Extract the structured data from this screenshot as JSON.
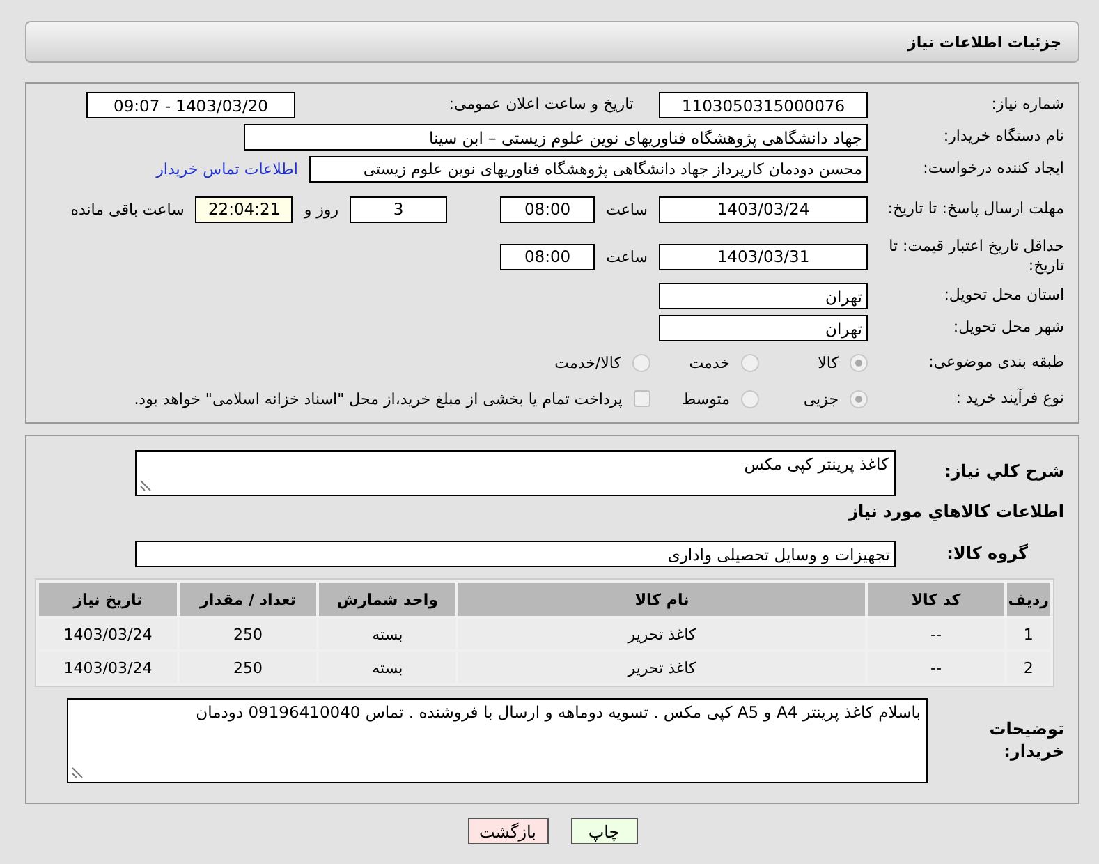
{
  "header": {
    "title": "جزئیات اطلاعات نیاز"
  },
  "details": {
    "need_number": {
      "label": "شماره نیاز:",
      "value": "1103050315000076"
    },
    "announce": {
      "label": "تاریخ و ساعت اعلان عمومی:",
      "value": "1403/03/20 - 09:07"
    },
    "buyer_org": {
      "label": "نام دستگاه خریدار:",
      "value": "جهاد دانشگاهی پژوهشگاه فناوریهای نوین علوم زیستی – ابن سینا"
    },
    "requester": {
      "label": "ایجاد کننده درخواست:",
      "value": "محسن دودمان کارپرداز جهاد دانشگاهی پژوهشگاه فناوریهای نوین علوم زیستی",
      "link": "اطلاعات تماس خریدار"
    },
    "deadline": {
      "label": "مهلت ارسال پاسخ: تا تاریخ:",
      "date": "1403/03/24",
      "time_label": "ساعت",
      "time": "08:00",
      "days": "3",
      "days_label": "روز و",
      "remaining": "22:04:21",
      "remaining_label": "ساعت باقی مانده"
    },
    "validity": {
      "label": "حداقل تاریخ اعتبار قیمت: تا تاریخ:",
      "date": "1403/03/31",
      "time_label": "ساعت",
      "time": "08:00"
    },
    "province": {
      "label": "استان محل تحویل:",
      "value": "تهران"
    },
    "city": {
      "label": "شهر محل تحویل:",
      "value": "تهران"
    },
    "category": {
      "label": "طبقه بندی موضوعی:",
      "options": [
        {
          "label": "کالا",
          "selected": true
        },
        {
          "label": "خدمت",
          "selected": false
        },
        {
          "label": "کالا/خدمت",
          "selected": false
        }
      ]
    },
    "process": {
      "label": "نوع فرآیند خرید :",
      "options": [
        {
          "label": "جزیی",
          "selected": true
        },
        {
          "label": "متوسط",
          "selected": false
        }
      ],
      "treasury": {
        "label": "پرداخت تمام یا بخشی از مبلغ خرید،از محل \"اسناد خزانه اسلامی\" خواهد بود.",
        "checked": false
      }
    }
  },
  "goods": {
    "description": {
      "label": "شرح کلي نياز:",
      "value": "کاغذ پرینتر کپی مکس"
    },
    "heading": "اطلاعات کالاهاي مورد نياز",
    "group": {
      "label": "گروه کالا:",
      "value": "تجهیزات و وسایل تحصیلی واداری"
    },
    "table": {
      "columns": [
        "ردیف",
        "کد کالا",
        "نام کالا",
        "واحد شمارش",
        "تعداد / مقدار",
        "تاریخ نیاز"
      ],
      "rows": [
        [
          "1",
          "--",
          "کاغذ تحریر",
          "بسته",
          "250",
          "1403/03/24"
        ],
        [
          "2",
          "--",
          "کاغذ تحریر",
          "بسته",
          "250",
          "1403/03/24"
        ]
      ]
    },
    "notes": {
      "label": "توضیحات خریدار:",
      "value": "باسلام کاغذ پرینتر A4 و A5 کپی مکس  . تسویه دوماهه و ارسال با فروشنده . تماس 09196410040 دودمان"
    }
  },
  "buttons": [
    {
      "label": "چاپ",
      "kind": "print"
    },
    {
      "label": "بازگشت",
      "kind": "back"
    }
  ]
}
